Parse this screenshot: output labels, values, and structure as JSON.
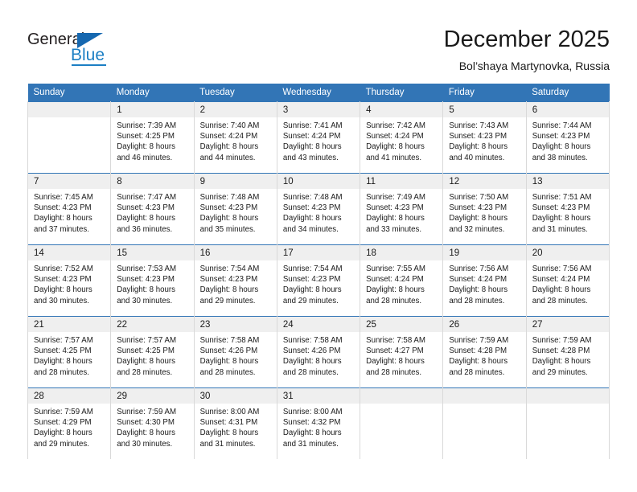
{
  "brand": {
    "name_part1": "General",
    "name_part2": "Blue",
    "accent_color": "#1668b0",
    "logo_icon": "triangle-logo-icon"
  },
  "header": {
    "month_title": "December 2025",
    "location": "Bol’shaya Martynovka, Russia"
  },
  "theme": {
    "header_row_color": "#3275b6",
    "daynum_band_color": "#efefef",
    "text_color": "#1a1a1a"
  },
  "weekday_headers": [
    "Sunday",
    "Monday",
    "Tuesday",
    "Wednesday",
    "Thursday",
    "Friday",
    "Saturday"
  ],
  "weeks": [
    [
      {
        "day": "",
        "sunrise": "",
        "sunset": "",
        "daylight_line1": "",
        "daylight_line2": ""
      },
      {
        "day": "1",
        "sunrise": "Sunrise: 7:39 AM",
        "sunset": "Sunset: 4:25 PM",
        "daylight_line1": "Daylight: 8 hours",
        "daylight_line2": "and 46 minutes."
      },
      {
        "day": "2",
        "sunrise": "Sunrise: 7:40 AM",
        "sunset": "Sunset: 4:24 PM",
        "daylight_line1": "Daylight: 8 hours",
        "daylight_line2": "and 44 minutes."
      },
      {
        "day": "3",
        "sunrise": "Sunrise: 7:41 AM",
        "sunset": "Sunset: 4:24 PM",
        "daylight_line1": "Daylight: 8 hours",
        "daylight_line2": "and 43 minutes."
      },
      {
        "day": "4",
        "sunrise": "Sunrise: 7:42 AM",
        "sunset": "Sunset: 4:24 PM",
        "daylight_line1": "Daylight: 8 hours",
        "daylight_line2": "and 41 minutes."
      },
      {
        "day": "5",
        "sunrise": "Sunrise: 7:43 AM",
        "sunset": "Sunset: 4:23 PM",
        "daylight_line1": "Daylight: 8 hours",
        "daylight_line2": "and 40 minutes."
      },
      {
        "day": "6",
        "sunrise": "Sunrise: 7:44 AM",
        "sunset": "Sunset: 4:23 PM",
        "daylight_line1": "Daylight: 8 hours",
        "daylight_line2": "and 38 minutes."
      }
    ],
    [
      {
        "day": "7",
        "sunrise": "Sunrise: 7:45 AM",
        "sunset": "Sunset: 4:23 PM",
        "daylight_line1": "Daylight: 8 hours",
        "daylight_line2": "and 37 minutes."
      },
      {
        "day": "8",
        "sunrise": "Sunrise: 7:47 AM",
        "sunset": "Sunset: 4:23 PM",
        "daylight_line1": "Daylight: 8 hours",
        "daylight_line2": "and 36 minutes."
      },
      {
        "day": "9",
        "sunrise": "Sunrise: 7:48 AM",
        "sunset": "Sunset: 4:23 PM",
        "daylight_line1": "Daylight: 8 hours",
        "daylight_line2": "and 35 minutes."
      },
      {
        "day": "10",
        "sunrise": "Sunrise: 7:48 AM",
        "sunset": "Sunset: 4:23 PM",
        "daylight_line1": "Daylight: 8 hours",
        "daylight_line2": "and 34 minutes."
      },
      {
        "day": "11",
        "sunrise": "Sunrise: 7:49 AM",
        "sunset": "Sunset: 4:23 PM",
        "daylight_line1": "Daylight: 8 hours",
        "daylight_line2": "and 33 minutes."
      },
      {
        "day": "12",
        "sunrise": "Sunrise: 7:50 AM",
        "sunset": "Sunset: 4:23 PM",
        "daylight_line1": "Daylight: 8 hours",
        "daylight_line2": "and 32 minutes."
      },
      {
        "day": "13",
        "sunrise": "Sunrise: 7:51 AM",
        "sunset": "Sunset: 4:23 PM",
        "daylight_line1": "Daylight: 8 hours",
        "daylight_line2": "and 31 minutes."
      }
    ],
    [
      {
        "day": "14",
        "sunrise": "Sunrise: 7:52 AM",
        "sunset": "Sunset: 4:23 PM",
        "daylight_line1": "Daylight: 8 hours",
        "daylight_line2": "and 30 minutes."
      },
      {
        "day": "15",
        "sunrise": "Sunrise: 7:53 AM",
        "sunset": "Sunset: 4:23 PM",
        "daylight_line1": "Daylight: 8 hours",
        "daylight_line2": "and 30 minutes."
      },
      {
        "day": "16",
        "sunrise": "Sunrise: 7:54 AM",
        "sunset": "Sunset: 4:23 PM",
        "daylight_line1": "Daylight: 8 hours",
        "daylight_line2": "and 29 minutes."
      },
      {
        "day": "17",
        "sunrise": "Sunrise: 7:54 AM",
        "sunset": "Sunset: 4:23 PM",
        "daylight_line1": "Daylight: 8 hours",
        "daylight_line2": "and 29 minutes."
      },
      {
        "day": "18",
        "sunrise": "Sunrise: 7:55 AM",
        "sunset": "Sunset: 4:24 PM",
        "daylight_line1": "Daylight: 8 hours",
        "daylight_line2": "and 28 minutes."
      },
      {
        "day": "19",
        "sunrise": "Sunrise: 7:56 AM",
        "sunset": "Sunset: 4:24 PM",
        "daylight_line1": "Daylight: 8 hours",
        "daylight_line2": "and 28 minutes."
      },
      {
        "day": "20",
        "sunrise": "Sunrise: 7:56 AM",
        "sunset": "Sunset: 4:24 PM",
        "daylight_line1": "Daylight: 8 hours",
        "daylight_line2": "and 28 minutes."
      }
    ],
    [
      {
        "day": "21",
        "sunrise": "Sunrise: 7:57 AM",
        "sunset": "Sunset: 4:25 PM",
        "daylight_line1": "Daylight: 8 hours",
        "daylight_line2": "and 28 minutes."
      },
      {
        "day": "22",
        "sunrise": "Sunrise: 7:57 AM",
        "sunset": "Sunset: 4:25 PM",
        "daylight_line1": "Daylight: 8 hours",
        "daylight_line2": "and 28 minutes."
      },
      {
        "day": "23",
        "sunrise": "Sunrise: 7:58 AM",
        "sunset": "Sunset: 4:26 PM",
        "daylight_line1": "Daylight: 8 hours",
        "daylight_line2": "and 28 minutes."
      },
      {
        "day": "24",
        "sunrise": "Sunrise: 7:58 AM",
        "sunset": "Sunset: 4:26 PM",
        "daylight_line1": "Daylight: 8 hours",
        "daylight_line2": "and 28 minutes."
      },
      {
        "day": "25",
        "sunrise": "Sunrise: 7:58 AM",
        "sunset": "Sunset: 4:27 PM",
        "daylight_line1": "Daylight: 8 hours",
        "daylight_line2": "and 28 minutes."
      },
      {
        "day": "26",
        "sunrise": "Sunrise: 7:59 AM",
        "sunset": "Sunset: 4:28 PM",
        "daylight_line1": "Daylight: 8 hours",
        "daylight_line2": "and 28 minutes."
      },
      {
        "day": "27",
        "sunrise": "Sunrise: 7:59 AM",
        "sunset": "Sunset: 4:28 PM",
        "daylight_line1": "Daylight: 8 hours",
        "daylight_line2": "and 29 minutes."
      }
    ],
    [
      {
        "day": "28",
        "sunrise": "Sunrise: 7:59 AM",
        "sunset": "Sunset: 4:29 PM",
        "daylight_line1": "Daylight: 8 hours",
        "daylight_line2": "and 29 minutes."
      },
      {
        "day": "29",
        "sunrise": "Sunrise: 7:59 AM",
        "sunset": "Sunset: 4:30 PM",
        "daylight_line1": "Daylight: 8 hours",
        "daylight_line2": "and 30 minutes."
      },
      {
        "day": "30",
        "sunrise": "Sunrise: 8:00 AM",
        "sunset": "Sunset: 4:31 PM",
        "daylight_line1": "Daylight: 8 hours",
        "daylight_line2": "and 31 minutes."
      },
      {
        "day": "31",
        "sunrise": "Sunrise: 8:00 AM",
        "sunset": "Sunset: 4:32 PM",
        "daylight_line1": "Daylight: 8 hours",
        "daylight_line2": "and 31 minutes."
      },
      {
        "day": "",
        "sunrise": "",
        "sunset": "",
        "daylight_line1": "",
        "daylight_line2": ""
      },
      {
        "day": "",
        "sunrise": "",
        "sunset": "",
        "daylight_line1": "",
        "daylight_line2": ""
      },
      {
        "day": "",
        "sunrise": "",
        "sunset": "",
        "daylight_line1": "",
        "daylight_line2": ""
      }
    ]
  ]
}
